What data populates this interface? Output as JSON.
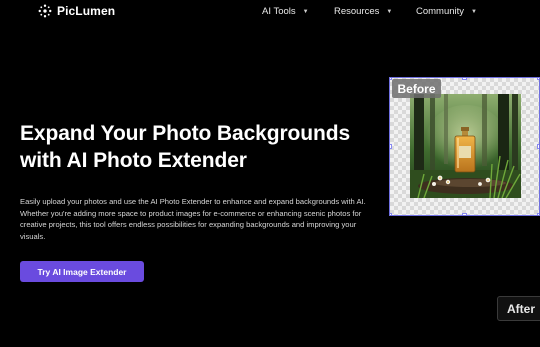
{
  "header": {
    "brand": "PicLumen",
    "nav": [
      {
        "label": "AI Tools"
      },
      {
        "label": "Resources"
      },
      {
        "label": "Community"
      }
    ]
  },
  "hero": {
    "title_line1": "Expand Your Photo Backgrounds",
    "title_line2": "with AI Photo Extender",
    "description": "Easily upload your photos and use the AI Photo Extender to enhance and expand backgrounds with AI. Whether you're adding more space to product images for e-commerce or enhancing scenic photos for creative projects, this tool offers endless possibilities for expanding backgrounds and improving your visuals.",
    "cta_label": "Try AI Image Extender"
  },
  "comparison": {
    "before_label": "Before",
    "after_label": "After"
  },
  "colors": {
    "background": "#000000",
    "accent": "#6a4bdf",
    "selection_border": "#6f6fe0"
  },
  "icons": {
    "logo": "piclumen-logo-icon",
    "dropdown": "chevron-down-icon"
  }
}
